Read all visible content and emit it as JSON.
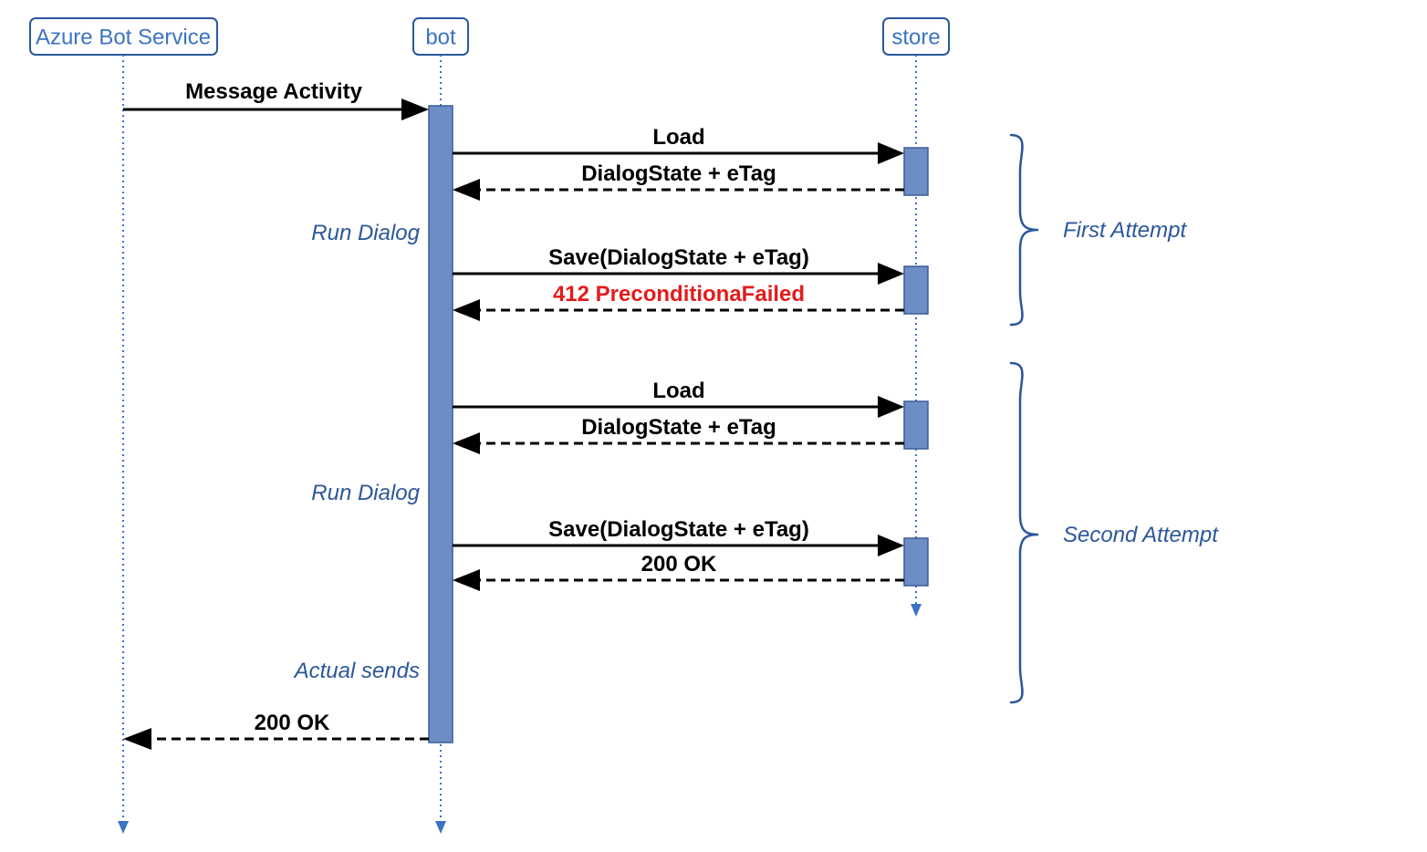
{
  "participants": {
    "azure": "Azure Bot Service",
    "bot": "bot",
    "store": "store"
  },
  "messages": {
    "msg_activity": "Message Activity",
    "load": "Load",
    "dialog_etag": "DialogState + eTag",
    "run_dialog": "Run Dialog",
    "save_dialog": "Save(DialogState + eTag)",
    "precondition_failed": "412 PreconditionaFailed",
    "ok200": "200 OK",
    "actual_sends": "Actual sends"
  },
  "annotations": {
    "first_attempt": "First Attempt",
    "second_attempt": "Second Attempt"
  },
  "colors": {
    "blue": "#2b579a",
    "red": "#e31b1b",
    "activation": "#6d8dc5"
  }
}
